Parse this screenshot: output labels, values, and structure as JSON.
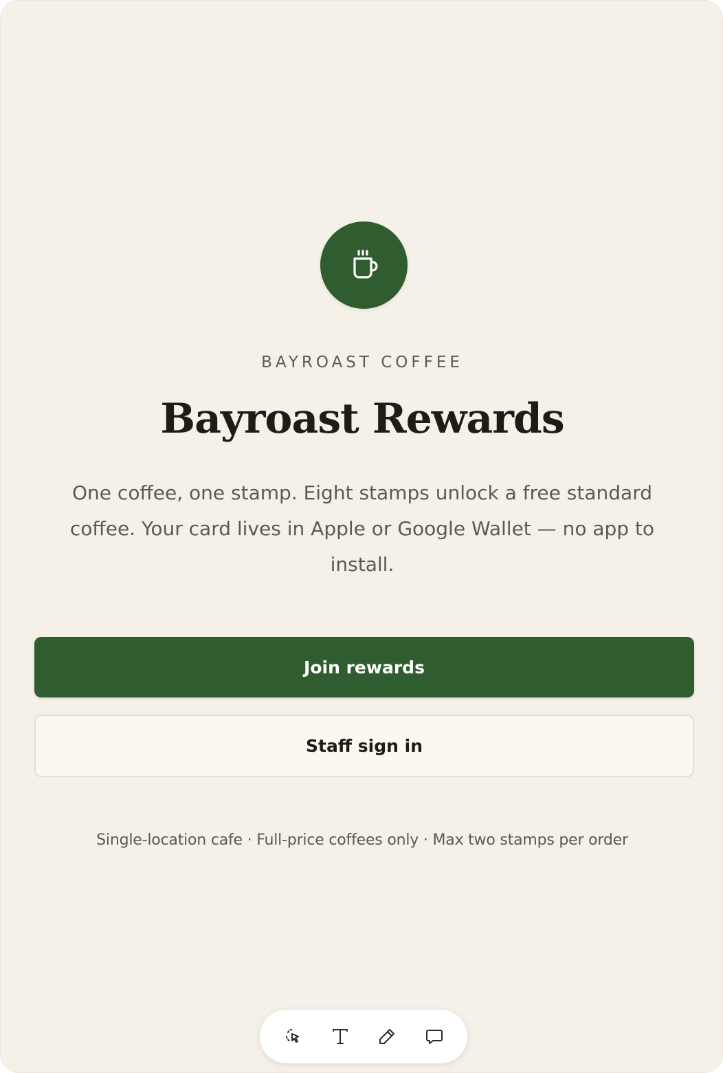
{
  "brand": {
    "eyebrow": "BAYROAST COFFEE",
    "logo_icon": "coffee-cup-icon",
    "accent_color": "#2f5d2f"
  },
  "hero": {
    "title": "Bayroast Rewards",
    "description": "One coffee, one stamp. Eight stamps unlock a free standard coffee. Your card lives in Apple or Google Wallet — no app to install."
  },
  "actions": {
    "join_label": "Join rewards",
    "staff_label": "Staff sign in"
  },
  "footnote": "Single-location cafe · Full-price coffees only · Max two stamps per order",
  "toolbar": {
    "tools": [
      {
        "icon": "select-cursor-icon"
      },
      {
        "icon": "text-icon"
      },
      {
        "icon": "pencil-icon"
      },
      {
        "icon": "comment-icon"
      }
    ]
  }
}
